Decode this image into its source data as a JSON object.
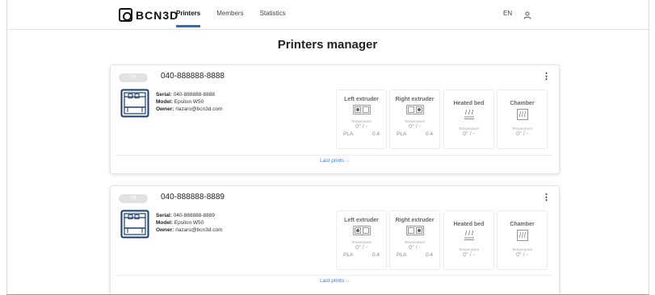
{
  "header": {
    "logo_text": "BCN3D",
    "nav": [
      {
        "label": "Printers",
        "active": true
      },
      {
        "label": "Members",
        "active": false
      },
      {
        "label": "Statistics",
        "active": false
      }
    ],
    "language": "EN",
    "user_icon": "user-icon"
  },
  "page_title": "Printers manager",
  "colors": {
    "accent": "#2a6fc0",
    "link": "#3b7bd8",
    "status_off": "#e2e2e2"
  },
  "printers": [
    {
      "status": "Off",
      "title": "040-888888-8888",
      "serial_label": "Serial:",
      "serial": "040-888888-8888",
      "model_label": "Model:",
      "model": "Epsilon W50",
      "owner_label": "Owner:",
      "owner": "rlazaro@bcn3d.com",
      "left_extruder": {
        "title": "Left extruder",
        "temp_label": "Temperature",
        "temp": "0° / -",
        "material": "PLA",
        "nozzle": "0.4"
      },
      "right_extruder": {
        "title": "Right extruder",
        "temp_label": "Temperature",
        "temp": "0° / -",
        "material": "PLA",
        "nozzle": "0.4"
      },
      "heated_bed": {
        "title": "Heated bed",
        "temp_label": "Temperature",
        "temp": "0° / -"
      },
      "chamber": {
        "title": "Chamber",
        "temp_label": "Temperature",
        "temp": "0° / -"
      },
      "last_prints": "Last prints"
    },
    {
      "status": "Off",
      "title": "040-888888-8889",
      "serial_label": "Serial:",
      "serial": "040-888888-8889",
      "model_label": "Model:",
      "model": "Epsilon W50",
      "owner_label": "Owner:",
      "owner": "rlazaro@bcn3d.com",
      "left_extruder": {
        "title": "Left extruder",
        "temp_label": "Temperature",
        "temp": "0° / -",
        "material": "PLA",
        "nozzle": "0.4"
      },
      "right_extruder": {
        "title": "Right extruder",
        "temp_label": "Temperature",
        "temp": "0° / -",
        "material": "PLA",
        "nozzle": "0.4"
      },
      "heated_bed": {
        "title": "Heated bed",
        "temp_label": "Temperature",
        "temp": "0° / -"
      },
      "chamber": {
        "title": "Chamber",
        "temp_label": "Temperature",
        "temp": "0° / -"
      },
      "last_prints": "Last prints"
    }
  ]
}
